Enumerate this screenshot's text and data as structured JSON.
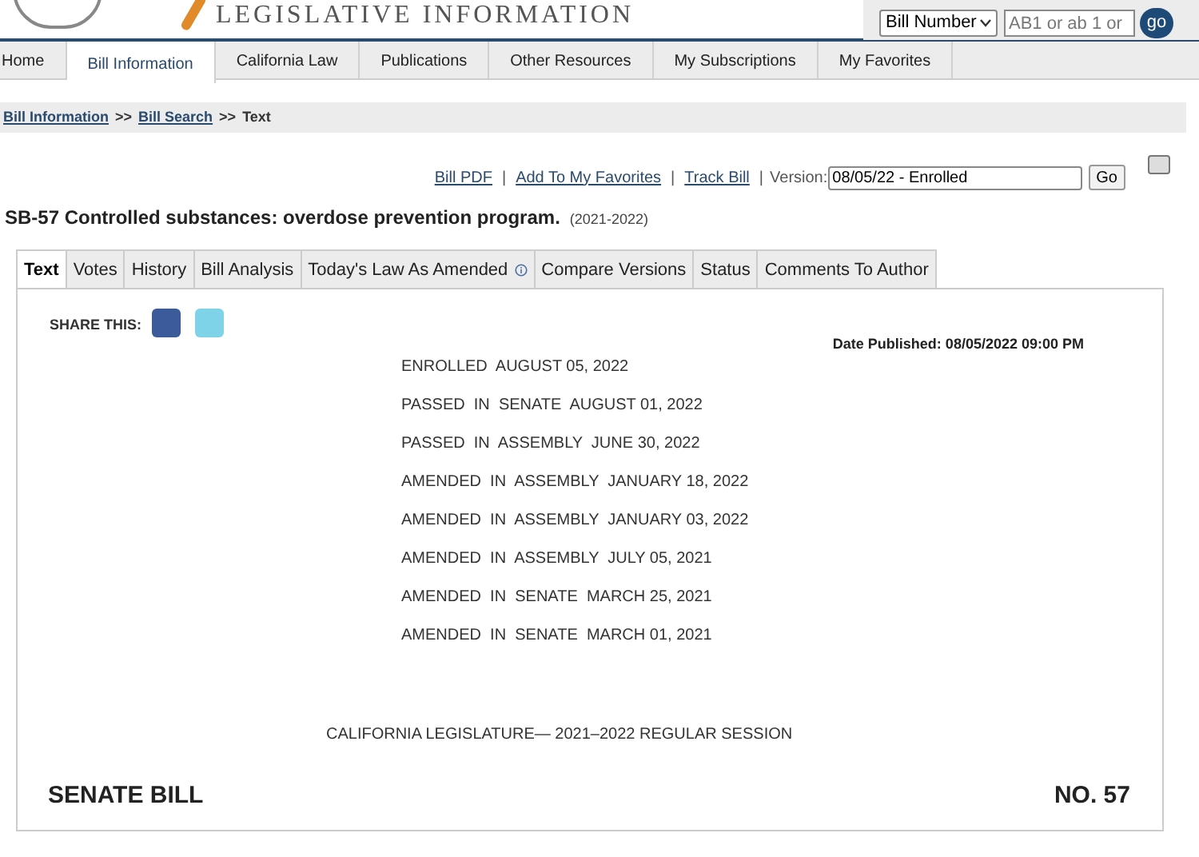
{
  "header": {
    "site_title": "LEGISLATIVE INFORMATION",
    "quick_search": {
      "type_value": "Bill Number",
      "placeholder": "AB1 or ab 1 or",
      "go": "go"
    }
  },
  "nav": [
    {
      "label": "Home",
      "selected": false
    },
    {
      "label": "Bill Information",
      "selected": true
    },
    {
      "label": "California Law",
      "selected": false
    },
    {
      "label": "Publications",
      "selected": false
    },
    {
      "label": "Other Resources",
      "selected": false
    },
    {
      "label": "My Subscriptions",
      "selected": false
    },
    {
      "label": "My Favorites",
      "selected": false
    }
  ],
  "breadcrumb": {
    "links": [
      "Bill Information",
      "Bill Search"
    ],
    "separator": ">>",
    "current": "Text"
  },
  "actions": {
    "links": [
      "Bill PDF",
      "Add To My Favorites",
      "Track Bill"
    ],
    "separator": "|",
    "version_label": "Version:",
    "version_value": "08/05/22 - Enrolled",
    "go": "Go"
  },
  "bill": {
    "title": "SB-57 Controlled substances: overdose prevention program.",
    "session": "(2021-2022)"
  },
  "tabs": [
    {
      "label": "Text",
      "selected": true,
      "info": false
    },
    {
      "label": "Votes",
      "selected": false,
      "info": false
    },
    {
      "label": "History",
      "selected": false,
      "info": false
    },
    {
      "label": "Bill Analysis",
      "selected": false,
      "info": false
    },
    {
      "label": "Today's Law As Amended",
      "selected": false,
      "info": true
    },
    {
      "label": "Compare Versions",
      "selected": false,
      "info": false
    },
    {
      "label": "Status",
      "selected": false,
      "info": false
    },
    {
      "label": "Comments To Author",
      "selected": false,
      "info": false
    }
  ],
  "share_label": "SHARE THIS:",
  "date_published": "Date Published: 08/05/2022 09:00 PM",
  "history": [
    "ENROLLED  AUGUST 05, 2022",
    "PASSED  IN  SENATE  AUGUST 01, 2022",
    "PASSED  IN  ASSEMBLY  JUNE 30, 2022",
    "AMENDED  IN  ASSEMBLY  JANUARY 18, 2022",
    "AMENDED  IN  ASSEMBLY  JANUARY 03, 2022",
    "AMENDED  IN  ASSEMBLY  JULY 05, 2021",
    "AMENDED  IN  SENATE  MARCH 25, 2021",
    "AMENDED  IN  SENATE  MARCH 01, 2021"
  ],
  "session_heading": "CALIFORNIA LEGISLATURE— 2021–2022 REGULAR SESSION",
  "bill_type": "SENATE BILL",
  "bill_number": "NO. 57"
}
